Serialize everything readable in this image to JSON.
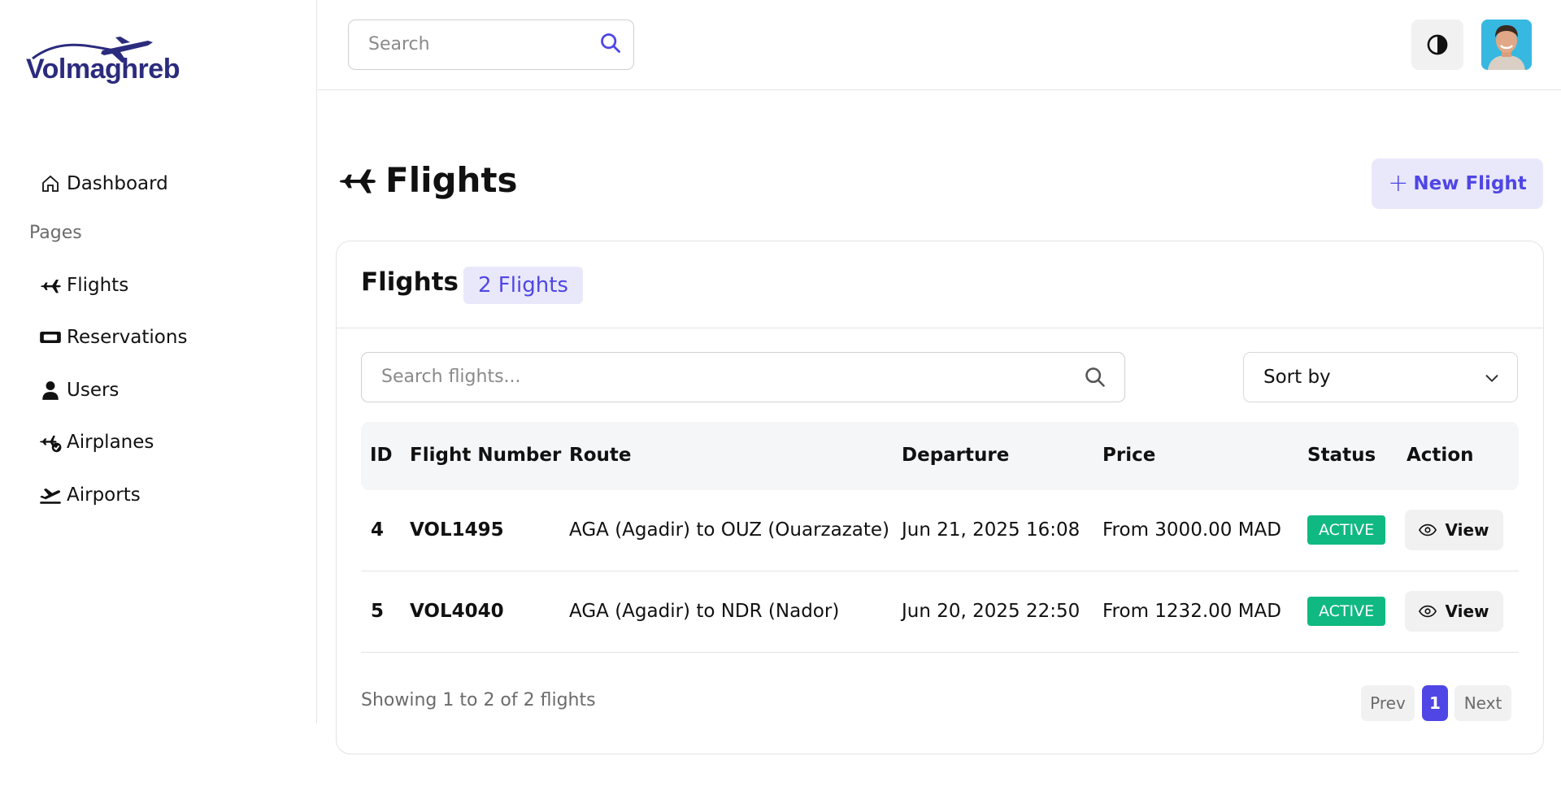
{
  "brand": {
    "name": "Volmaghreb",
    "color": "#2b2b7e"
  },
  "accent": "#4f46e5",
  "sidebar": {
    "dashboard_label": "Dashboard",
    "section_label": "Pages",
    "items": [
      {
        "label": "Flights",
        "icon": "airplane-icon"
      },
      {
        "label": "Reservations",
        "icon": "ticket-icon"
      },
      {
        "label": "Users",
        "icon": "user-icon"
      },
      {
        "label": "Airplanes",
        "icon": "airplane-check-icon"
      },
      {
        "label": "Airports",
        "icon": "plane-departure-icon"
      }
    ]
  },
  "topbar": {
    "search_placeholder": "Search",
    "theme_icon": "contrast-icon",
    "avatar": "user-avatar"
  },
  "page": {
    "title": "Flights",
    "new_button_plus": "+",
    "new_button_label": "New Flight"
  },
  "card": {
    "title": "Flights",
    "count_badge": "2 Flights",
    "search_placeholder": "Search flights...",
    "sort_label": "Sort by"
  },
  "table": {
    "headers": [
      "ID",
      "Flight Number",
      "Route",
      "Departure",
      "Price",
      "Status",
      "Action"
    ],
    "rows": [
      {
        "id": "4",
        "flight_number": "VOL1495",
        "route": "AGA (Agadir) to OUZ (Ouarzazate)",
        "departure": "Jun 21, 2025 16:08",
        "price": "From 3000.00 MAD",
        "status": "ACTIVE",
        "action": "View"
      },
      {
        "id": "5",
        "flight_number": "VOL4040",
        "route": "AGA (Agadir) to NDR (Nador)",
        "departure": "Jun 20, 2025 22:50",
        "price": "From 1232.00 MAD",
        "status": "ACTIVE",
        "action": "View"
      }
    ],
    "status_color": "#10b981"
  },
  "footer": {
    "showing": "Showing 1 to 2 of 2 flights",
    "prev": "Prev",
    "current_page": "1",
    "next": "Next"
  }
}
